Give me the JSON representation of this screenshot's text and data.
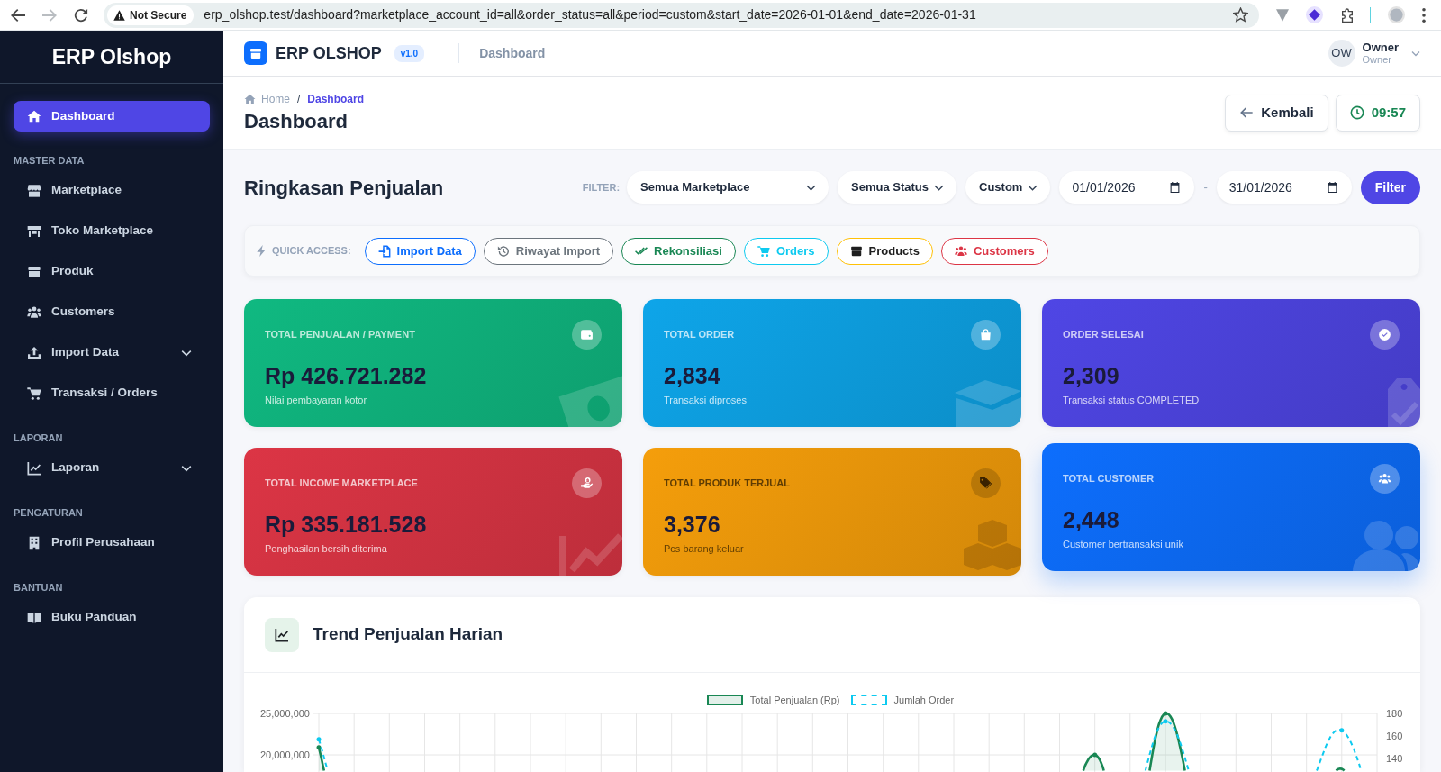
{
  "browser": {
    "nav_buttons": [
      {
        "kind": "back",
        "disabled": false
      },
      {
        "kind": "forward",
        "disabled": true
      },
      {
        "kind": "reload",
        "disabled": false
      }
    ],
    "security": "Not Secure",
    "url": "erp_olshop.test/dashboard?marketplace_account_id=all&order_status=all&period=custom&start_date=2026-01-01&end_date=2026-01-31"
  },
  "sidebar": {
    "brand": "ERP Olshop",
    "groups": [
      {
        "items": [
          {
            "label": "Dashboard",
            "kind": "link",
            "selected": true
          }
        ]
      },
      {
        "heading": "MASTER DATA",
        "items": [
          {
            "label": "Marketplace",
            "kind": "link",
            "selected": false
          },
          {
            "label": "Toko Marketplace",
            "kind": "link",
            "selected": false
          },
          {
            "label": "Produk",
            "kind": "link",
            "selected": false
          },
          {
            "label": "Customers",
            "kind": "link",
            "selected": false
          },
          {
            "label": "Import Data",
            "kind": "dropdown",
            "expanded": false,
            "selected": false
          },
          {
            "label": "Transaksi / Orders",
            "kind": "link",
            "selected": false
          }
        ]
      },
      {
        "heading": "LAPORAN",
        "items": [
          {
            "label": "Laporan",
            "kind": "dropdown",
            "expanded": false,
            "selected": false
          }
        ]
      },
      {
        "heading": "PENGATURAN",
        "items": [
          {
            "label": "Profil Perusahaan",
            "kind": "link",
            "selected": false
          }
        ]
      },
      {
        "heading": "BANTUAN",
        "items": [
          {
            "label": "Buku Panduan",
            "kind": "link",
            "selected": false
          }
        ]
      }
    ]
  },
  "topbar": {
    "brand": "ERP OLSHOP",
    "version": "v1.0",
    "page": "Dashboard",
    "user": {
      "initials": "OW",
      "name": "Owner",
      "role": "Owner"
    }
  },
  "page_header": {
    "breadcrumb": [
      {
        "label": "Home",
        "current": false
      },
      {
        "label": "Dashboard",
        "current": true
      }
    ],
    "breadcrumb_separator": "/",
    "title": "Dashboard",
    "buttons": [
      {
        "kind": "back",
        "label": "Kembali"
      },
      {
        "kind": "clock",
        "label": "09:57"
      }
    ]
  },
  "summary": {
    "title": "Ringkasan Penjualan",
    "filter_label": "FILTER:",
    "selects": [
      {
        "value": "Semua Marketplace"
      },
      {
        "value": "Semua Status"
      },
      {
        "value": "Custom"
      }
    ],
    "start_date": "01/01/2026",
    "date_separator": "-",
    "end_date": "31/01/2026",
    "filter_button": "Filter"
  },
  "quick_access": {
    "label": "QUICK ACCESS:",
    "buttons": [
      {
        "label": "Import Data",
        "color": "#0d6efd"
      },
      {
        "label": "Riwayat Import",
        "color": "#6c757d"
      },
      {
        "label": "Rekonsiliasi",
        "color": "#198754"
      },
      {
        "label": "Orders",
        "color": "#0dcaf0"
      },
      {
        "label": "Products",
        "color": "#ffc107"
      },
      {
        "label": "Customers",
        "color": "#dc3545"
      }
    ]
  },
  "stat_cards": [
    {
      "title": "TOTAL PENJUALAN / PAYMENT",
      "value": "Rp 426.721.282",
      "caption": "Nilai pembayaran kotor",
      "color": "#10b981",
      "hovered": false
    },
    {
      "title": "TOTAL ORDER",
      "value": "2,834",
      "caption": "Transaksi diproses",
      "color": "#0ea5e9",
      "hovered": false
    },
    {
      "title": "ORDER SELESAI",
      "value": "2,309",
      "caption": "Transaksi status COMPLETED",
      "color": "#4f46e5",
      "hovered": false
    },
    {
      "title": "TOTAL INCOME MARKETPLACE",
      "value": "Rp 335.181.528",
      "caption": "Penghasilan bersih diterima",
      "color": "#dc3545",
      "hovered": false
    },
    {
      "title": "TOTAL PRODUK TERJUAL",
      "value": "3,376",
      "caption": "Pcs barang keluar",
      "color": "#f59e0b",
      "hovered": false
    },
    {
      "title": "TOTAL CUSTOMER",
      "value": "2,448",
      "caption": "Customer bertransaksi unik",
      "color": "#0d6efd",
      "hovered": true
    }
  ],
  "chart": {
    "title": "Trend Penjualan Harian",
    "legend": [
      {
        "label": "Total Penjualan (Rp)",
        "color": "#198754",
        "kind": "solid"
      },
      {
        "label": "Jumlah Order",
        "color": "#0dcaf0",
        "kind": "dashed"
      }
    ],
    "left_axis_ticks": [
      "25,000,000",
      "20,000,000"
    ],
    "right_axis_ticks": [
      "180",
      "160",
      "140"
    ]
  }
}
